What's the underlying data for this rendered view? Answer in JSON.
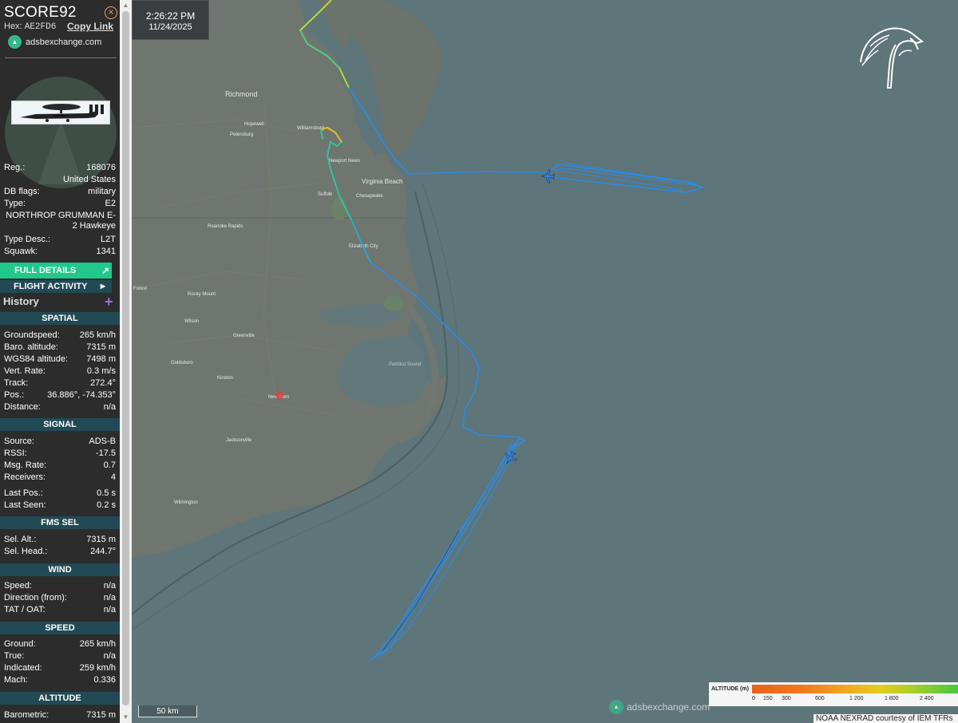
{
  "aircraft": {
    "callsign": "SCORE92",
    "hex_label": "Hex:",
    "hex": "AE2FD6",
    "copy_link": "Copy Link",
    "source_site": "adsbexchange.com"
  },
  "details": {
    "reg_label": "Reg.:",
    "reg": "168076",
    "country": "United States",
    "dbflags_label": "DB flags:",
    "dbflags": "military",
    "type_label": "Type:",
    "type": "E2",
    "type_full": "NORTHROP GRUMMAN E-2 Hawkeye",
    "typedesc_label": "Type Desc.:",
    "typedesc": "L2T",
    "squawk_label": "Squawk:",
    "squawk": "1341"
  },
  "buttons": {
    "full_details": "FULL DETAILS",
    "flight_activity": "FLIGHT ACTIVITY",
    "history": "History"
  },
  "spatial": {
    "header": "SPATIAL",
    "rows": [
      {
        "k": "Groundspeed:",
        "v": "265 km/h"
      },
      {
        "k": "Baro. altitude:",
        "v": "7315 m"
      },
      {
        "k": "WGS84 altitude:",
        "v": "7498 m"
      },
      {
        "k": "Vert. Rate:",
        "v": "0.3 m/s"
      },
      {
        "k": "Track:",
        "v": "272.4°"
      },
      {
        "k": "Pos.:",
        "v": "36.886°, -74.353°"
      },
      {
        "k": "Distance:",
        "v": "n/a"
      }
    ]
  },
  "signal": {
    "header": "SIGNAL",
    "rows": [
      {
        "k": "Source:",
        "v": "ADS-B"
      },
      {
        "k": "RSSI:",
        "v": "-17.5"
      },
      {
        "k": "Msg. Rate:",
        "v": "0.7"
      },
      {
        "k": "Receivers:",
        "v": "4"
      },
      {
        "k": "Last Pos.:",
        "v": "0.5 s"
      },
      {
        "k": "Last Seen:",
        "v": "0.2 s"
      }
    ]
  },
  "fms": {
    "header": "FMS SEL",
    "rows": [
      {
        "k": "Sel. Alt.:",
        "v": "7315 m"
      },
      {
        "k": "Sel. Head.:",
        "v": "244.7°"
      }
    ]
  },
  "wind": {
    "header": "WIND",
    "rows": [
      {
        "k": "Speed:",
        "v": "n/a"
      },
      {
        "k": "Direction (from):",
        "v": "n/a"
      },
      {
        "k": "TAT / OAT:",
        "v": "n/a"
      }
    ]
  },
  "speed": {
    "header": "SPEED",
    "rows": [
      {
        "k": "Ground:",
        "v": "265 km/h"
      },
      {
        "k": "True:",
        "v": "n/a"
      },
      {
        "k": "Indicated:",
        "v": "259 km/h"
      },
      {
        "k": "Mach:",
        "v": "0.336"
      }
    ]
  },
  "altitude": {
    "header": "ALTITUDE",
    "rows": [
      {
        "k": "Barometric:",
        "v": "7315 m"
      }
    ]
  },
  "clock": {
    "time": "2:26:22 PM",
    "date": "11/24/2025"
  },
  "map": {
    "scale": "50 km",
    "watermark": "adsbexchange.com",
    "attribution": "NOAA NEXRAD courtesy of IEM TFRs",
    "legend_title": "ALTITUDE (m)",
    "legend_ticks": [
      "0",
      "150",
      "300",
      "600",
      "1 200",
      "1 800",
      "2 400"
    ],
    "places": [
      "Richmond",
      "Hopewell",
      "Petersburg",
      "Williamsburg",
      "Newport News",
      "Virginia Beach",
      "Chesapeake",
      "Suffolk",
      "Roanoke Rapids",
      "Elizabeth City",
      "Rocky Mount",
      "Wilson",
      "Greenville",
      "Goldsboro",
      "Kinston",
      "New Bern",
      "Jacksonville",
      "Wilmington",
      "Pamlico Sound",
      "Forest"
    ]
  },
  "colors": {
    "sidebar_bg": "#2c2c2c",
    "section_header": "#214a55",
    "full_details": "#20c98a",
    "ocean": "#5e7579",
    "track": "#2b8be8"
  }
}
